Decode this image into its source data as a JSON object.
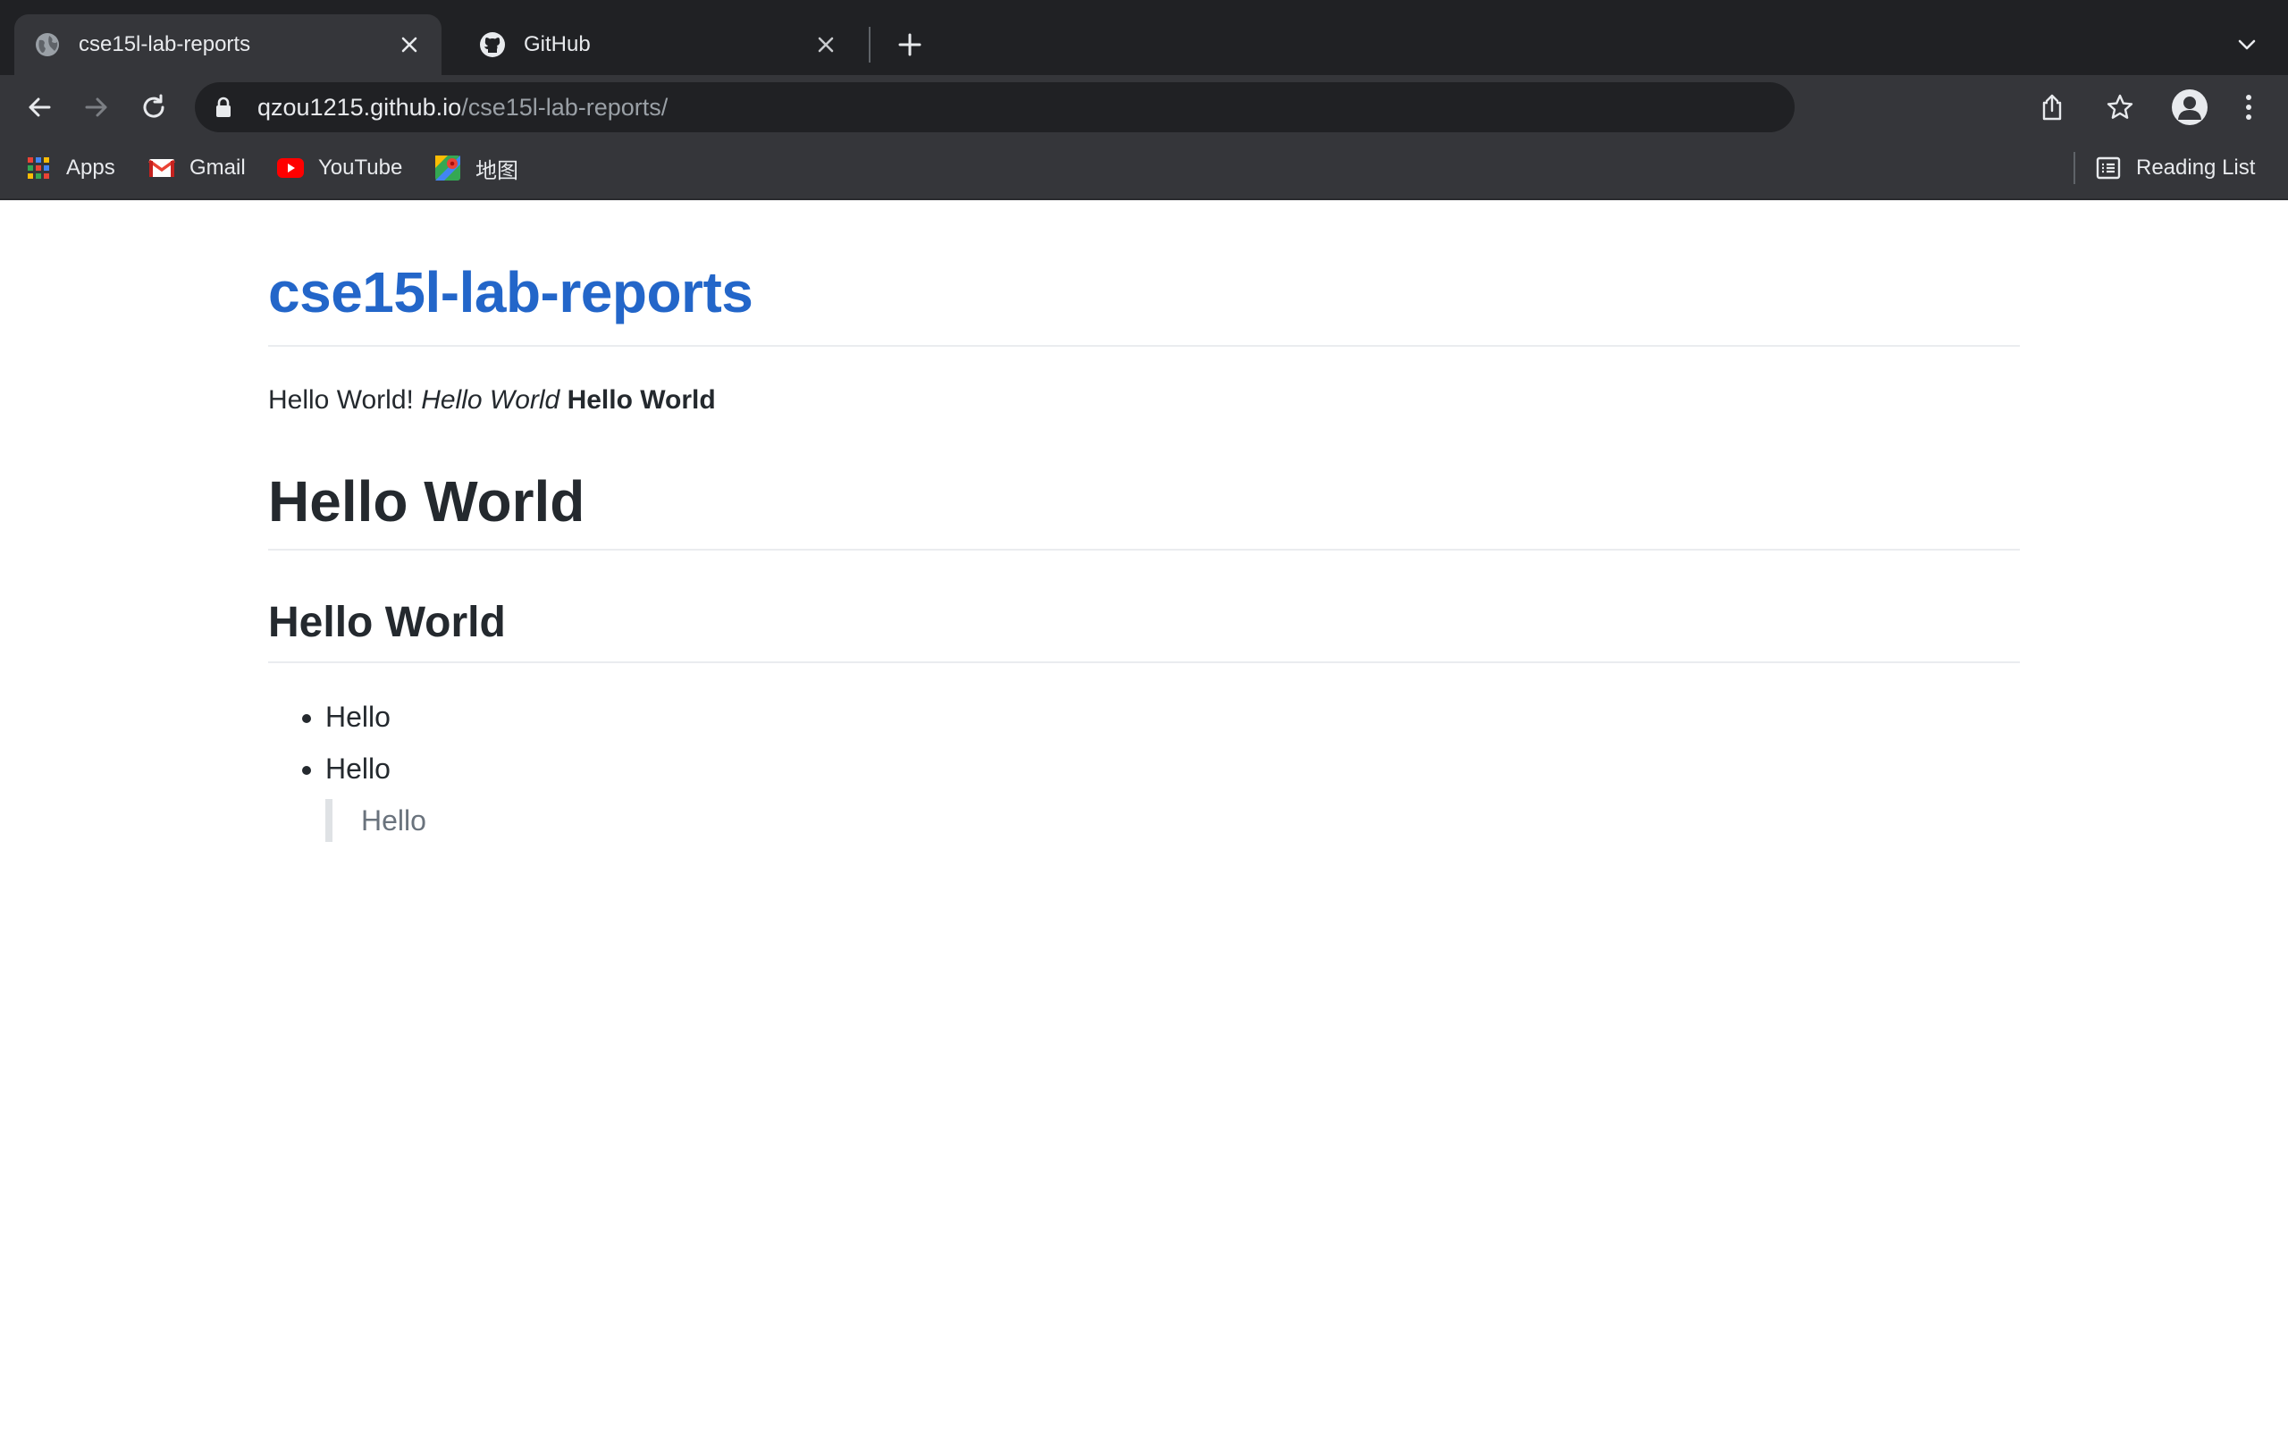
{
  "browser": {
    "tabs": [
      {
        "title": "cse15l-lab-reports",
        "active": true,
        "favicon": "globe-icon"
      },
      {
        "title": "GitHub",
        "active": false,
        "favicon": "github-icon"
      }
    ],
    "omnibox": {
      "host": "qzou1215.github.io",
      "path": "/cse15l-lab-reports/"
    },
    "bookmarks": [
      {
        "label": "Apps",
        "icon": "apps-grid-icon"
      },
      {
        "label": "Gmail",
        "icon": "gmail-icon"
      },
      {
        "label": "YouTube",
        "icon": "youtube-icon"
      },
      {
        "label": "地图",
        "icon": "maps-icon"
      }
    ],
    "reading_list": "Reading List"
  },
  "page": {
    "site_title": "cse15l-lab-reports",
    "intro": {
      "plain": "Hello World!",
      "italic": "Hello World",
      "bold": "Hello World"
    },
    "heading1": "Hello World",
    "heading2": "Hello World",
    "list_items": [
      "Hello",
      "Hello"
    ],
    "blockquote": "Hello"
  },
  "colors": {
    "chrome_dark": "#202124",
    "chrome_toolbar": "#35363a",
    "link_blue": "#2366c9",
    "text": "#24292e",
    "muted": "#6a737d"
  }
}
